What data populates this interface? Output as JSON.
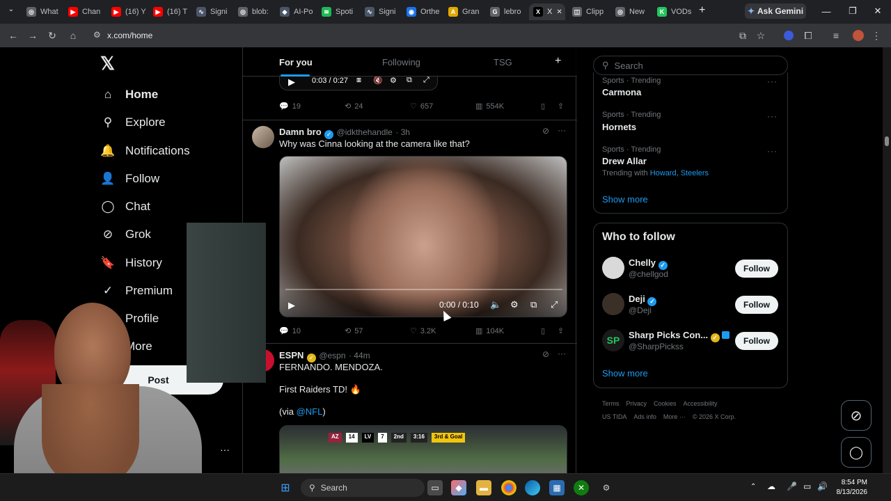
{
  "browser": {
    "tabs": [
      {
        "label": "What",
        "color": "#5f6368",
        "glyph": "◎"
      },
      {
        "label": "Chan",
        "color": "#ff0000",
        "glyph": "▶"
      },
      {
        "label": "(16) Y",
        "color": "#ff0000",
        "glyph": "▶"
      },
      {
        "label": "(16) T",
        "color": "#ff0000",
        "glyph": "▶"
      },
      {
        "label": "Signi",
        "color": "#4a5568",
        "glyph": "∿"
      },
      {
        "label": "blob:",
        "color": "#5f6368",
        "glyph": "◎"
      },
      {
        "label": "AI-Po",
        "color": "#4a5568",
        "glyph": "◆"
      },
      {
        "label": "Spoti",
        "color": "#1db954",
        "glyph": "≋"
      },
      {
        "label": "Signi",
        "color": "#4a5568",
        "glyph": "∿"
      },
      {
        "label": "Orthe",
        "color": "#1a73e8",
        "glyph": "◉"
      },
      {
        "label": "Gran",
        "color": "#e0a800",
        "glyph": "A"
      },
      {
        "label": "lebro",
        "color": "#5f6368",
        "glyph": "G"
      },
      {
        "label": "X",
        "color": "#000000",
        "glyph": "X"
      },
      {
        "label": "Clipp",
        "color": "#5f6368",
        "glyph": "◫"
      },
      {
        "label": "New",
        "color": "#5f6368",
        "glyph": "◎"
      },
      {
        "label": "VODs",
        "color": "#22c55e",
        "glyph": "K"
      }
    ],
    "new_tab": "+",
    "ask_gemini": "Ask Gemini",
    "url": "x.com/home"
  },
  "nav": {
    "items": [
      {
        "label": "Home",
        "icon": "home-icon",
        "glyph": "⌂"
      },
      {
        "label": "Explore",
        "icon": "search-icon",
        "glyph": "⚲"
      },
      {
        "label": "Notifications",
        "icon": "bell-icon",
        "glyph": "🔔"
      },
      {
        "label": "Follow",
        "icon": "person-add-icon",
        "glyph": "👤"
      },
      {
        "label": "Chat",
        "icon": "chat-icon",
        "glyph": "◯"
      },
      {
        "label": "Grok",
        "icon": "grok-icon",
        "glyph": "⊘"
      },
      {
        "label": "History",
        "icon": "bookmark-icon",
        "glyph": "🔖"
      },
      {
        "label": "Premium",
        "icon": "premium-icon",
        "glyph": "✓"
      },
      {
        "label": "Profile",
        "icon": "profile-icon",
        "glyph": "👤"
      },
      {
        "label": "More",
        "icon": "more-icon",
        "glyph": "⋯"
      }
    ],
    "post": "Post",
    "account_more": "···",
    "account_fragment": "ee"
  },
  "feed": {
    "tabs": [
      "For you",
      "Following",
      "TSG"
    ],
    "add_tab": "+",
    "top_video_time": "0:03 / 0:27",
    "top_actions": {
      "replies": "19",
      "reposts": "24",
      "likes": "657",
      "views": "554K"
    },
    "tweet1": {
      "name": "Damn bro",
      "handle": "@idkthehandle",
      "time": "· 3h",
      "text": "Why was Cinna looking at the camera like that?",
      "video_time": "0:00 / 0:10",
      "actions": {
        "replies": "10",
        "reposts": "57",
        "likes": "3.2K",
        "views": "104K"
      }
    },
    "tweet2": {
      "name": "ESPN",
      "handle": "@espn",
      "time": "· 44m",
      "line1": "FERNANDO. MENDOZA.",
      "line2": "First Raiders TD! 🔥",
      "line3_prefix": "(via ",
      "line3_link": "@NFL",
      "line3_suffix": ")",
      "score": {
        "away": "AZ",
        "away_score": "14",
        "home": "LV",
        "home_score": "7",
        "quarter": "2nd",
        "clock": "3:16",
        "play": "3rd & Goal"
      }
    }
  },
  "right": {
    "search_placeholder": "Search",
    "trends": [
      {
        "category": "Sports · Trending",
        "name": "Carmona"
      },
      {
        "category": "Sports · Trending",
        "name": "Hornets"
      },
      {
        "category": "Sports · Trending",
        "name": "Drew Allar",
        "with_prefix": "Trending with",
        "with_links": "Howard, Steelers"
      }
    ],
    "show_more": "Show more",
    "wtf_title": "Who to follow",
    "wtf": [
      {
        "name": "Chelly",
        "handle": "@chellgod",
        "button": "Follow",
        "avatar_color": "#d9d9d9"
      },
      {
        "name": "Deji",
        "handle": "@Deji",
        "button": "Follow",
        "avatar_color": "#3a3028"
      },
      {
        "name": "Sharp Picks Con...",
        "handle": "@SharpPickss",
        "button": "Follow",
        "avatar_color": "#1a1a1a"
      }
    ],
    "wtf_show_more": "Show more",
    "footer_row1": [
      "Terms",
      "Privacy",
      "Cookies",
      "Accessibility"
    ],
    "footer_row2": [
      "US TIDA",
      "Ads info",
      "More ···",
      "© 2026 X Corp."
    ]
  },
  "taskbar": {
    "search": "Search",
    "time": "8:54 PM",
    "date": "8/13/2026"
  }
}
